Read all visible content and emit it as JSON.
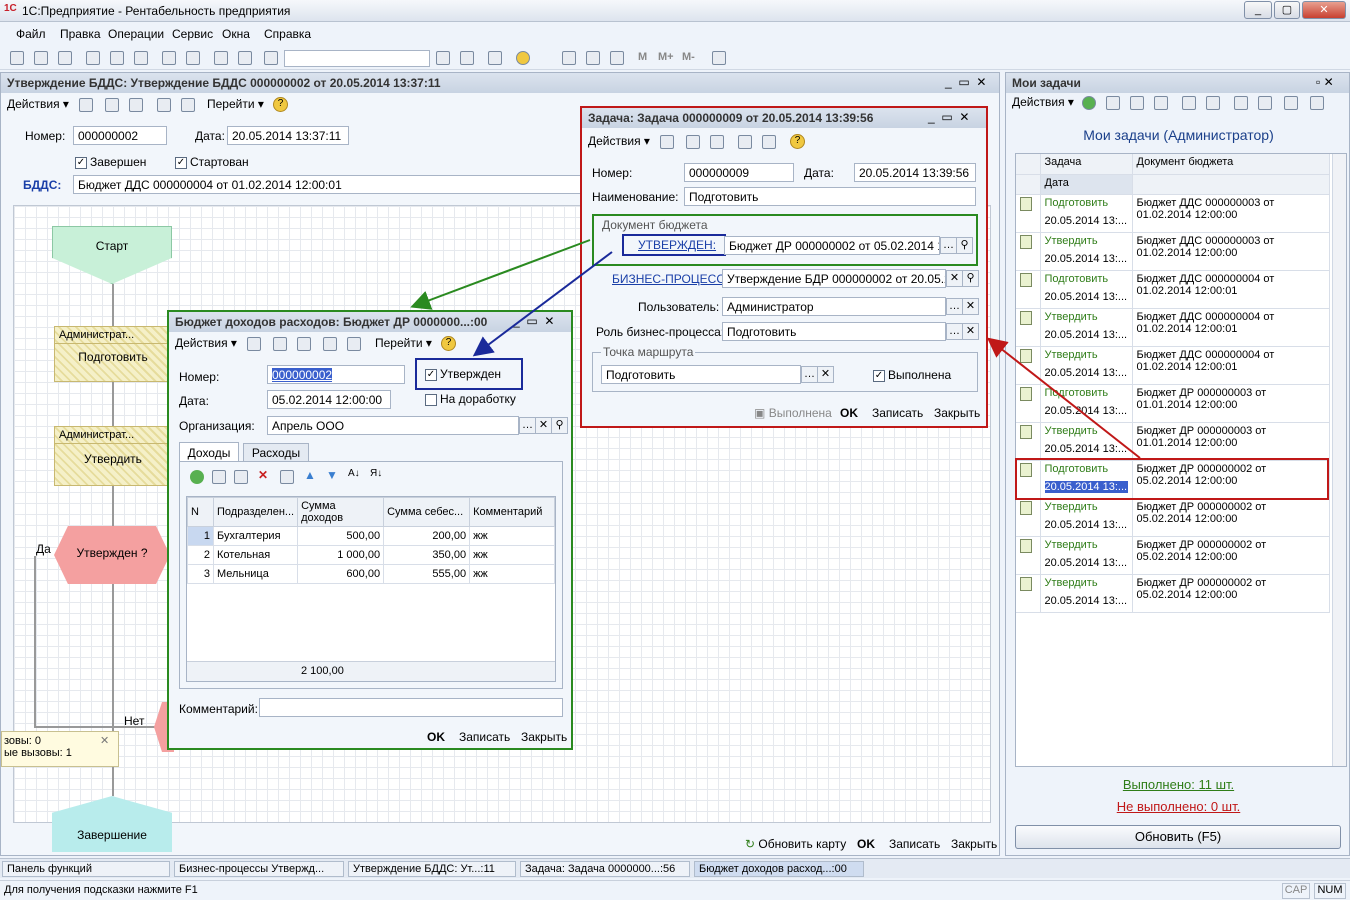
{
  "app": {
    "title": "1С:Предприятие - Рентабельность предприятия",
    "logo": "1С"
  },
  "menu": [
    "Файл",
    "Правка",
    "Операции",
    "Сервис",
    "Окна",
    "Справка"
  ],
  "bdds": {
    "title": "Утверждение БДДС: Утверждение БДДС 000000002 от 20.05.2014 13:37:11",
    "actions": "Действия",
    "goto": "Перейти",
    "number_label": "Номер:",
    "number": "000000002",
    "date_label": "Дата:",
    "date": "20.05.2014 13:37:11",
    "done": "Завершен",
    "started": "Стартован",
    "bdds_label": "БДДС:",
    "bdds_value": "Бюджет ДДС 000000004 от 01.02.2014 12:00:01",
    "flow": {
      "start": "Старт",
      "admin1": "Администрат...",
      "prepare": "Подготовить",
      "admin2": "Администрат...",
      "approve": "Утвердить",
      "decision": "Утвержден ?",
      "yes": "Да",
      "no": "Нет",
      "end": "Завершение"
    },
    "calls": [
      "зовы: 0",
      "ые вызовы: 1"
    ],
    "refresh_map": "Обновить карту",
    "ok": "OK",
    "save": "Записать",
    "close": "Закрыть"
  },
  "task": {
    "title": "Задача: Задача 000000009 от 20.05.2014 13:39:56",
    "actions": "Действия",
    "number_label": "Номер:",
    "number": "000000009",
    "date_label": "Дата:",
    "date": "20.05.2014 13:39:56",
    "name_label": "Наименование:",
    "name": "Подготовить",
    "group_doc": "Документ бюджета",
    "approved_link": "УТВЕРЖДЕН:",
    "doc_value": "Бюджет ДР 000000002 от 05.02.2014 1:",
    "bp_link": "БИЗНЕС-ПРОЦЕСС:",
    "bp_value": "Утверждение БДР 000000002 от 20.05.2",
    "user_label": "Пользователь:",
    "user": "Администратор",
    "role_label": "Роль бизнес-процесса:",
    "role": "Подготовить",
    "group_route": "Точка маршрута",
    "route": "Подготовить",
    "done": "Выполнена",
    "btn_done": "Выполнена",
    "ok": "OK",
    "save": "Записать",
    "close": "Закрыть"
  },
  "budget": {
    "title": "Бюджет доходов расходов: Бюджет ДР 0000000...:00",
    "actions": "Действия",
    "goto": "Перейти",
    "number_label": "Номер:",
    "number": "000000002",
    "approved": "Утвержден",
    "date_label": "Дата:",
    "date": "05.02.2014 12:00:00",
    "rework": "На доработку",
    "org_label": "Организация:",
    "org": "Апрель ООО",
    "tabs": [
      "Доходы",
      "Расходы"
    ],
    "columns": [
      "N",
      "Подразделен...",
      "Сумма доходов",
      "Сумма себес...",
      "Комментарий"
    ],
    "rows": [
      [
        "1",
        "Бухгалтерия",
        "500,00",
        "200,00",
        "жж"
      ],
      [
        "2",
        "Котельная",
        "1 000,00",
        "350,00",
        "жж"
      ],
      [
        "3",
        "Мельница",
        "600,00",
        "555,00",
        "жж"
      ]
    ],
    "total": "2 100,00",
    "comment_label": "Комментарий:",
    "ok": "OK",
    "save": "Записать",
    "close": "Закрыть"
  },
  "mytasks": {
    "title": "Мои задачи",
    "actions": "Действия",
    "heading": "Мои задачи (Администратор)",
    "col_task": "Задача",
    "col_date": "Дата",
    "col_doc": "Документ бюджета",
    "rows": [
      [
        "Подготовить",
        "20.05.2014 13:...",
        "Бюджет ДДС 000000003 от",
        "01.02.2014 12:00:00"
      ],
      [
        "Утвердить",
        "20.05.2014 13:...",
        "Бюджет ДДС 000000003 от",
        "01.02.2014 12:00:00"
      ],
      [
        "Подготовить",
        "20.05.2014 13:...",
        "Бюджет ДДС 000000004 от",
        "01.02.2014 12:00:01"
      ],
      [
        "Утвердить",
        "20.05.2014 13:...",
        "Бюджет ДДС 000000004 от",
        "01.02.2014 12:00:01"
      ],
      [
        "Утвердить",
        "20.05.2014 13:...",
        "Бюджет ДДС 000000004 от",
        "01.02.2014 12:00:01"
      ],
      [
        "Подготовить",
        "20.05.2014 13:...",
        "Бюджет ДР 000000003 от",
        "01.01.2014 12:00:00"
      ],
      [
        "Утвердить",
        "20.05.2014 13:...",
        "Бюджет ДР 000000003 от",
        "01.01.2014 12:00:00"
      ],
      [
        "Подготовить",
        "20.05.2014 13:...",
        "Бюджет ДР 000000002 от",
        "05.02.2014 12:00:00"
      ],
      [
        "Утвердить",
        "20.05.2014 13:...",
        "Бюджет ДР 000000002 от",
        "05.02.2014 12:00:00"
      ],
      [
        "Утвердить",
        "20.05.2014 13:...",
        "Бюджет ДР 000000002 от",
        "05.02.2014 12:00:00"
      ],
      [
        "Утвердить",
        "20.05.2014 13:...",
        "Бюджет ДР 000000002 от",
        "05.02.2014 12:00:00"
      ]
    ],
    "done": "Выполнено: 11 шт.",
    "not_done": "Не выполнено: 0 шт.",
    "refresh": "Обновить (F5)"
  },
  "taskbar": [
    "Панель функций",
    "Бизнес-процессы Утвержд...",
    "Утверждение БДДС: Ут...:11",
    "Задача: Задача 0000000...:56",
    "Бюджет доходов расход...:00"
  ],
  "status": {
    "hint": "Для получения подсказки нажмите F1",
    "cap": "CAP",
    "num": "NUM"
  },
  "colors": {
    "red_frame": "#c01818",
    "green_frame": "#2a8a20",
    "blue_frame": "#1a2a9a",
    "selected": "#3a5fcd"
  }
}
